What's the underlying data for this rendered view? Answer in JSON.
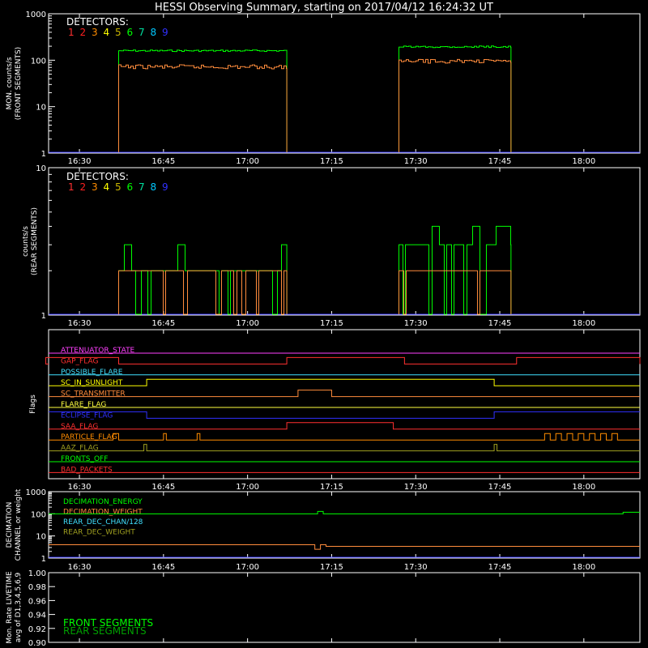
{
  "title": "HESSI Observing Summary, starting on 2017/04/12 16:24:32 UT",
  "time_ticks": [
    "16:30",
    "16:45",
    "17:00",
    "17:15",
    "17:30",
    "17:45",
    "18:00"
  ],
  "detectors": {
    "label": "DETECTORS:",
    "numbers": [
      "1",
      "2",
      "3",
      "4",
      "5",
      "6",
      "7",
      "8",
      "9"
    ],
    "colors": [
      "#ff3030",
      "#ff2020",
      "#ff8c00",
      "#ffff00",
      "#c8b400",
      "#00ff00",
      "#00e0a0",
      "#00c8ff",
      "#3030ff"
    ]
  },
  "colors": {
    "green": "#00ff00",
    "orange": "#ff8c3c",
    "blue": "#3030ff",
    "white": "#ffffff"
  },
  "chart_data": [
    {
      "type": "line",
      "ylabel": "MON. counts/s (FRONT SEGMENTS)",
      "ylabel_lines": [
        "MON. counts/s",
        "(FRONT SEGMENTS)"
      ],
      "yscale": "log",
      "ylim": [
        1,
        1000
      ],
      "yticks": [
        "1",
        "10",
        "100",
        "1000"
      ],
      "series": [
        {
          "color": "#00ff00",
          "segments": [
            {
              "start": "16:37",
              "end": "17:07",
              "value": 160
            },
            {
              "start": "17:27",
              "end": "17:47",
              "value": 195
            }
          ]
        },
        {
          "color": "#ff8c3c",
          "segments": [
            {
              "start": "16:37",
              "end": "17:07",
              "value": 72
            },
            {
              "start": "17:27",
              "end": "17:47",
              "value": 95
            }
          ]
        }
      ]
    },
    {
      "type": "line",
      "ylabel": "counts/s (REAR SEGMENTS)",
      "ylabel_lines": [
        "counts/s",
        "(REAR SEGMENTS)"
      ],
      "yscale": "log",
      "ylim": [
        1,
        10
      ],
      "yticks": [
        "1",
        "10"
      ],
      "series": [
        {
          "color": "#00ff00",
          "segments": [
            {
              "start": "16:37",
              "end": "17:07",
              "value": 2
            },
            {
              "start": "17:27",
              "end": "17:47",
              "value": 3
            }
          ]
        },
        {
          "color": "#ff8c3c",
          "segments": [
            {
              "start": "16:37",
              "end": "17:07",
              "value": 2
            },
            {
              "start": "17:27",
              "end": "17:47",
              "value": 2
            }
          ]
        }
      ]
    },
    {
      "type": "line",
      "ylabel": "Flags",
      "flags": [
        {
          "name": "ATTENUATOR_STATE",
          "color": "#ff40ff"
        },
        {
          "name": "GAP_FLAG",
          "color": "#ff3030"
        },
        {
          "name": "POSSIBLE_FLARE",
          "color": "#40e0ff"
        },
        {
          "name": "SC_IN_SUNLIGHT",
          "color": "#ffff00"
        },
        {
          "name": "SC_TRANSMITTER",
          "color": "#ff8c3c"
        },
        {
          "name": "FLARE_FLAG",
          "color": "#ffff40"
        },
        {
          "name": "ECLIPSE_FLAG",
          "color": "#3030ff"
        },
        {
          "name": "SAA_FLAG",
          "color": "#ff3030"
        },
        {
          "name": "PARTICLE_FLAG",
          "color": "#ff8c00"
        },
        {
          "name": "AAZ_FLAG",
          "color": "#a0a020"
        },
        {
          "name": "FRONTS_OFF",
          "color": "#00ff00"
        },
        {
          "name": "BAD_PACKETS",
          "color": "#ff3030"
        }
      ]
    },
    {
      "type": "line",
      "ylabel": "DECIMATION CHANNEL or weight",
      "ylabel_lines": [
        "DECIMATION",
        "CHANNEL or weight"
      ],
      "yscale": "log",
      "ylim": [
        1,
        1000
      ],
      "yticks": [
        "1",
        "10",
        "100",
        "1000"
      ],
      "legend": [
        {
          "name": "DECIMATION_ENERGY",
          "color": "#00ff00"
        },
        {
          "name": "DECIMATION_WEIGHT",
          "color": "#ff8c3c"
        },
        {
          "name": "REAR_DEC_CHAN/128",
          "color": "#40e0ff"
        },
        {
          "name": "REAR_DEC_WEIGHT",
          "color": "#a0a020"
        }
      ]
    },
    {
      "type": "line",
      "ylabel": "Mon. Rate LIVETIME avg of D1,3,4,5,6,9",
      "ylabel_lines": [
        "Mon. Rate LIVETIME",
        "avg of D1,3,4,5,6,9"
      ],
      "ylim": [
        0.9,
        1.0
      ],
      "yticks": [
        "0.90",
        "0.92",
        "0.94",
        "0.96",
        "0.98",
        "1.00"
      ],
      "legend": [
        {
          "name": "FRONT SEGMENTS",
          "color": "#00ff00"
        },
        {
          "name": "REAR SEGMENTS",
          "color": "#00a000"
        }
      ]
    }
  ]
}
